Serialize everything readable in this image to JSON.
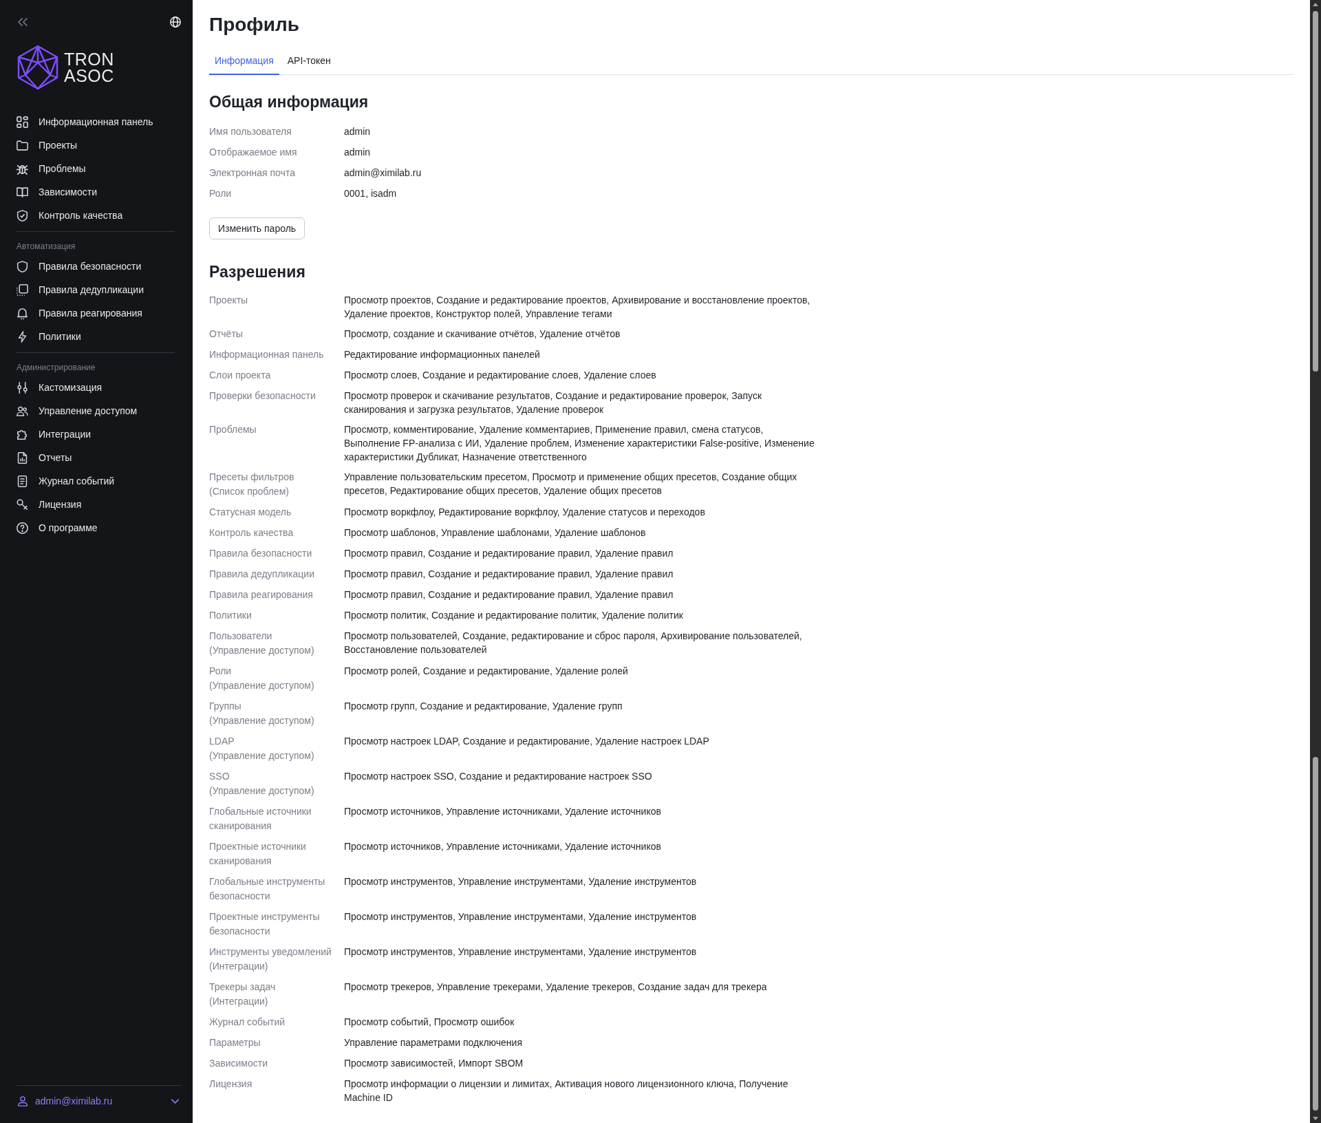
{
  "sidebar": {
    "logo": {
      "lines": [
        "TRON",
        "ASOC"
      ]
    },
    "nav_groups": [
      {
        "items": [
          {
            "label": "Информационная панель",
            "selected": false
          },
          {
            "label": "Проекты",
            "selected": false
          },
          {
            "label": "Проблемы",
            "selected": false
          },
          {
            "label": "Зависимости",
            "selected": false
          },
          {
            "label": "Контроль качества",
            "selected": false
          }
        ]
      },
      {
        "heading": "Автоматизация",
        "items": [
          {
            "label": "Правила безопасности",
            "selected": false
          },
          {
            "label": "Правила дедупликации",
            "selected": false
          },
          {
            "label": "Правила реагирования",
            "selected": false
          },
          {
            "label": "Политики",
            "selected": false
          }
        ]
      },
      {
        "heading": "Администрирование",
        "items": [
          {
            "label": "Кастомизация",
            "selected": false
          },
          {
            "label": "Управление доступом",
            "selected": false
          },
          {
            "label": "Интеграции",
            "selected": false
          },
          {
            "label": "Отчеты",
            "selected": false
          },
          {
            "label": "Журнал событий",
            "selected": false
          },
          {
            "label": "Лицензия",
            "selected": false
          },
          {
            "label": "О программе",
            "selected": false
          }
        ]
      }
    ],
    "user": {
      "email": "admin@ximilab.ru"
    }
  },
  "page": {
    "title": "Профиль",
    "tabs": [
      {
        "label": "Информация",
        "selected": true
      },
      {
        "label": "API-токен",
        "selected": false
      }
    ],
    "general": {
      "heading": "Общая информация",
      "fields": [
        {
          "label": "Имя пользователя",
          "value": "admin"
        },
        {
          "label": "Отображаемое имя",
          "value": "admin"
        },
        {
          "label": "Электронная почта",
          "value": "admin@ximilab.ru"
        },
        {
          "label": "Роли",
          "value": "0001, isadm"
        }
      ],
      "button": "Изменить пароль"
    },
    "permissions": {
      "heading": "Разрешения",
      "rows": [
        {
          "label": "Проекты",
          "value": "Просмотр проектов, Создание и редактирование проектов, Архивирование и восстановление проектов, Удаление проектов, Конструктор полей, Управление тегами"
        },
        {
          "label": "Отчёты",
          "value": "Просмотр, создание и скачивание отчётов, Удаление отчётов"
        },
        {
          "label": "Информационная панель",
          "value": "Редактирование информационных панелей"
        },
        {
          "label": "Слои проекта",
          "value": "Просмотр слоев, Создание и редактирование слоев, Удаление слоев"
        },
        {
          "label": "Проверки безопасности",
          "value": "Просмотр проверок и скачивание результатов, Создание и редактирование проверок, Запуск сканирования и загрузка результатов, Удаление проверок"
        },
        {
          "label": "Проблемы",
          "value": "Просмотр, комментирование, Удаление комментариев, Применение правил, смена статусов, Выполнение FP-анализа с ИИ, Удаление проблем, Изменение характеристики False-positive, Изменение характеристики Дубликат, Назначение ответственного"
        },
        {
          "label": "Пресеты фильтров",
          "scope": "(Список проблем)",
          "value": "Управление пользовательским пресетом, Просмотр и применение общих пресетов, Создание общих пресетов, Редактирование общих пресетов, Удаление общих пресетов"
        },
        {
          "label": "Статусная модель",
          "value": "Просмотр воркфлоу, Редактирование воркфлоу, Удаление статусов и переходов"
        },
        {
          "label": "Контроль качества",
          "value": "Просмотр шаблонов, Управление шаблонами, Удаление шаблонов"
        },
        {
          "label": "Правила безопасности",
          "value": "Просмотр правил, Создание и редактирование правил, Удаление правил"
        },
        {
          "label": "Правила дедупликации",
          "value": "Просмотр правил, Создание и редактирование правил, Удаление правил"
        },
        {
          "label": "Правила реагирования",
          "value": "Просмотр правил, Создание и редактирование правил, Удаление правил"
        },
        {
          "label": "Политики",
          "value": "Просмотр политик, Создание и редактирование политик, Удаление политик"
        },
        {
          "label": "Пользователи",
          "scope": "(Управление доступом)",
          "value": "Просмотр пользователей, Создание, редактирование и сброс пароля, Архивирование пользователей, Восстановление пользователей"
        },
        {
          "label": "Роли",
          "scope": "(Управление доступом)",
          "value": "Просмотр ролей, Создание и редактирование, Удаление ролей"
        },
        {
          "label": "Группы",
          "scope": "(Управление доступом)",
          "value": "Просмотр групп, Создание и редактирование, Удаление групп"
        },
        {
          "label": "LDAP",
          "scope": "(Управление доступом)",
          "value": "Просмотр настроек LDAP, Создание и редактирование, Удаление настроек LDAP"
        },
        {
          "label": "SSO",
          "scope": "(Управление доступом)",
          "value": "Просмотр настроек SSO, Создание и редактирование настроек SSO"
        },
        {
          "label": "Глобальные источники сканирования",
          "value": "Просмотр источников, Управление источниками, Удаление источников"
        },
        {
          "label": "Проектные источники сканирования",
          "value": "Просмотр источников, Управление источниками, Удаление источников"
        },
        {
          "label": "Глобальные инструменты безопасности",
          "value": "Просмотр инструментов, Управление инструментами, Удаление инструментов"
        },
        {
          "label": "Проектные инструменты безопасности",
          "value": "Просмотр инструментов, Управление инструментами, Удаление инструментов"
        },
        {
          "label": "Инструменты уведомлений",
          "scope": "(Интеграции)",
          "value": "Просмотр инструментов, Управление инструментами, Удаление инструментов"
        },
        {
          "label": "Трекеры задач",
          "scope": "(Интеграции)",
          "value": "Просмотр трекеров, Управление трекерами, Удаление трекеров, Создание задач для трекера"
        },
        {
          "label": "Журнал событий",
          "value": "Просмотр событий, Просмотр ошибок"
        },
        {
          "label": "Параметры",
          "value": "Управление параметрами подключения"
        },
        {
          "label": "Зависимости",
          "value": "Просмотр зависимостей, Импорт SBOM"
        },
        {
          "label": "Лицензия",
          "value": "Просмотр информации о лицензии и лимитах, Активация нового лицензионного ключа, Получение Machine ID"
        }
      ]
    }
  }
}
